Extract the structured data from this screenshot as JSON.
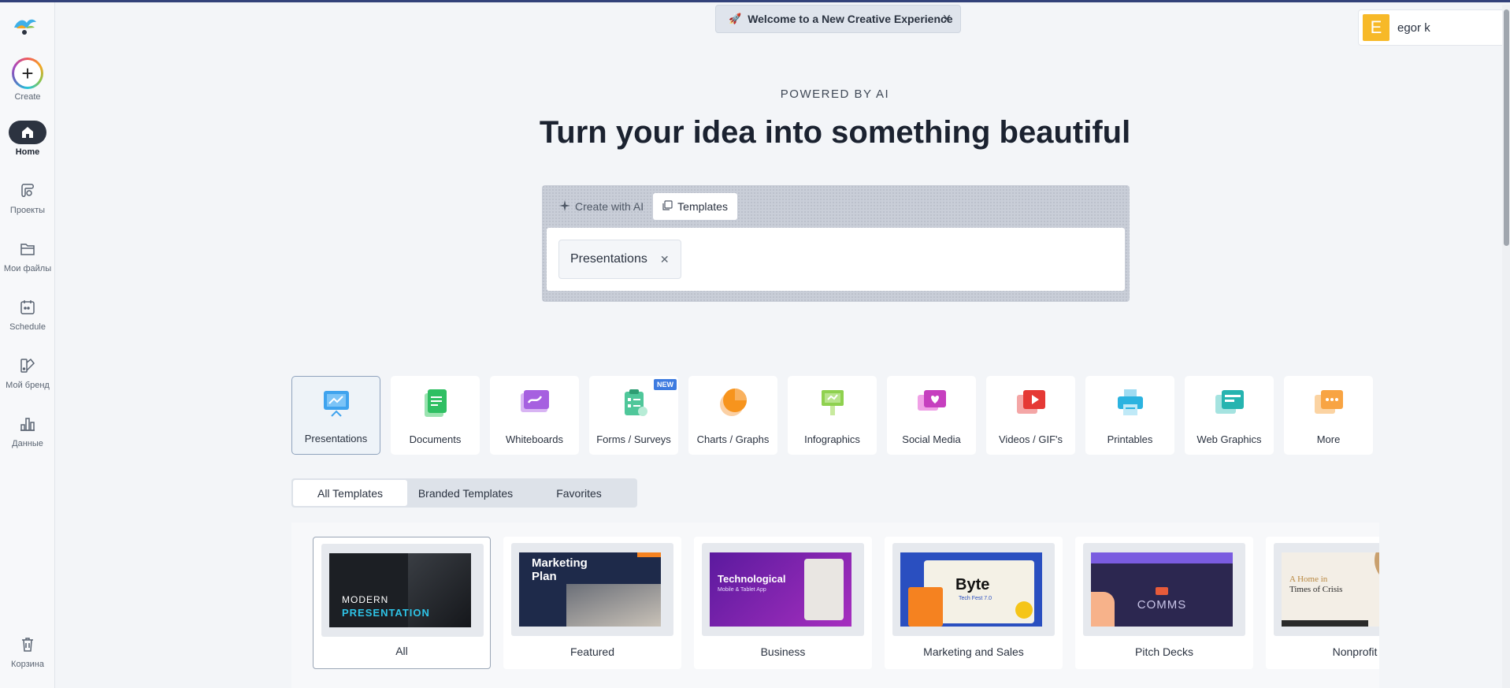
{
  "nav": {
    "create": "Create",
    "home": "Home",
    "projects": "Проекты",
    "files": "Мои файлы",
    "schedule": "Schedule",
    "brand": "Мой бренд",
    "data": "Данные",
    "trash": "Корзина"
  },
  "banner": {
    "text": "Welcome to a New Creative Experience",
    "close": "X"
  },
  "user": {
    "initial": "E",
    "name": "egor k"
  },
  "hero": {
    "eyebrow": "POWERED BY AI",
    "title": "Turn your idea into something beautiful"
  },
  "search": {
    "tab_ai": "Create with AI",
    "tab_templates": "Templates",
    "chip": "Presentations"
  },
  "categories": [
    {
      "label": "Presentations"
    },
    {
      "label": "Documents"
    },
    {
      "label": "Whiteboards"
    },
    {
      "label": "Forms / Surveys",
      "badge": "NEW"
    },
    {
      "label": "Charts / Graphs"
    },
    {
      "label": "Infographics"
    },
    {
      "label": "Social Media"
    },
    {
      "label": "Videos / GIF's"
    },
    {
      "label": "Printables"
    },
    {
      "label": "Web Graphics"
    },
    {
      "label": "More"
    }
  ],
  "filters": [
    "All Templates",
    "Branded Templates",
    "Favorites"
  ],
  "templates": [
    {
      "label": "All",
      "thumb_line1": "MODERN",
      "thumb_line2": "PRESENTATION"
    },
    {
      "label": "Featured",
      "thumb_line1": "Marketing",
      "thumb_line2": "Plan"
    },
    {
      "label": "Business",
      "thumb_line1": "Technological",
      "thumb_line2": "Mobile & Tablet App"
    },
    {
      "label": "Marketing and Sales",
      "thumb_line1": "Byte",
      "thumb_line2": "Tech Fest 7.0"
    },
    {
      "label": "Pitch Decks",
      "thumb_line1": "COMMS",
      "thumb_line2": ""
    },
    {
      "label": "Nonprofit",
      "thumb_line1": "A Home in",
      "thumb_line2": "Times of Crisis"
    }
  ]
}
